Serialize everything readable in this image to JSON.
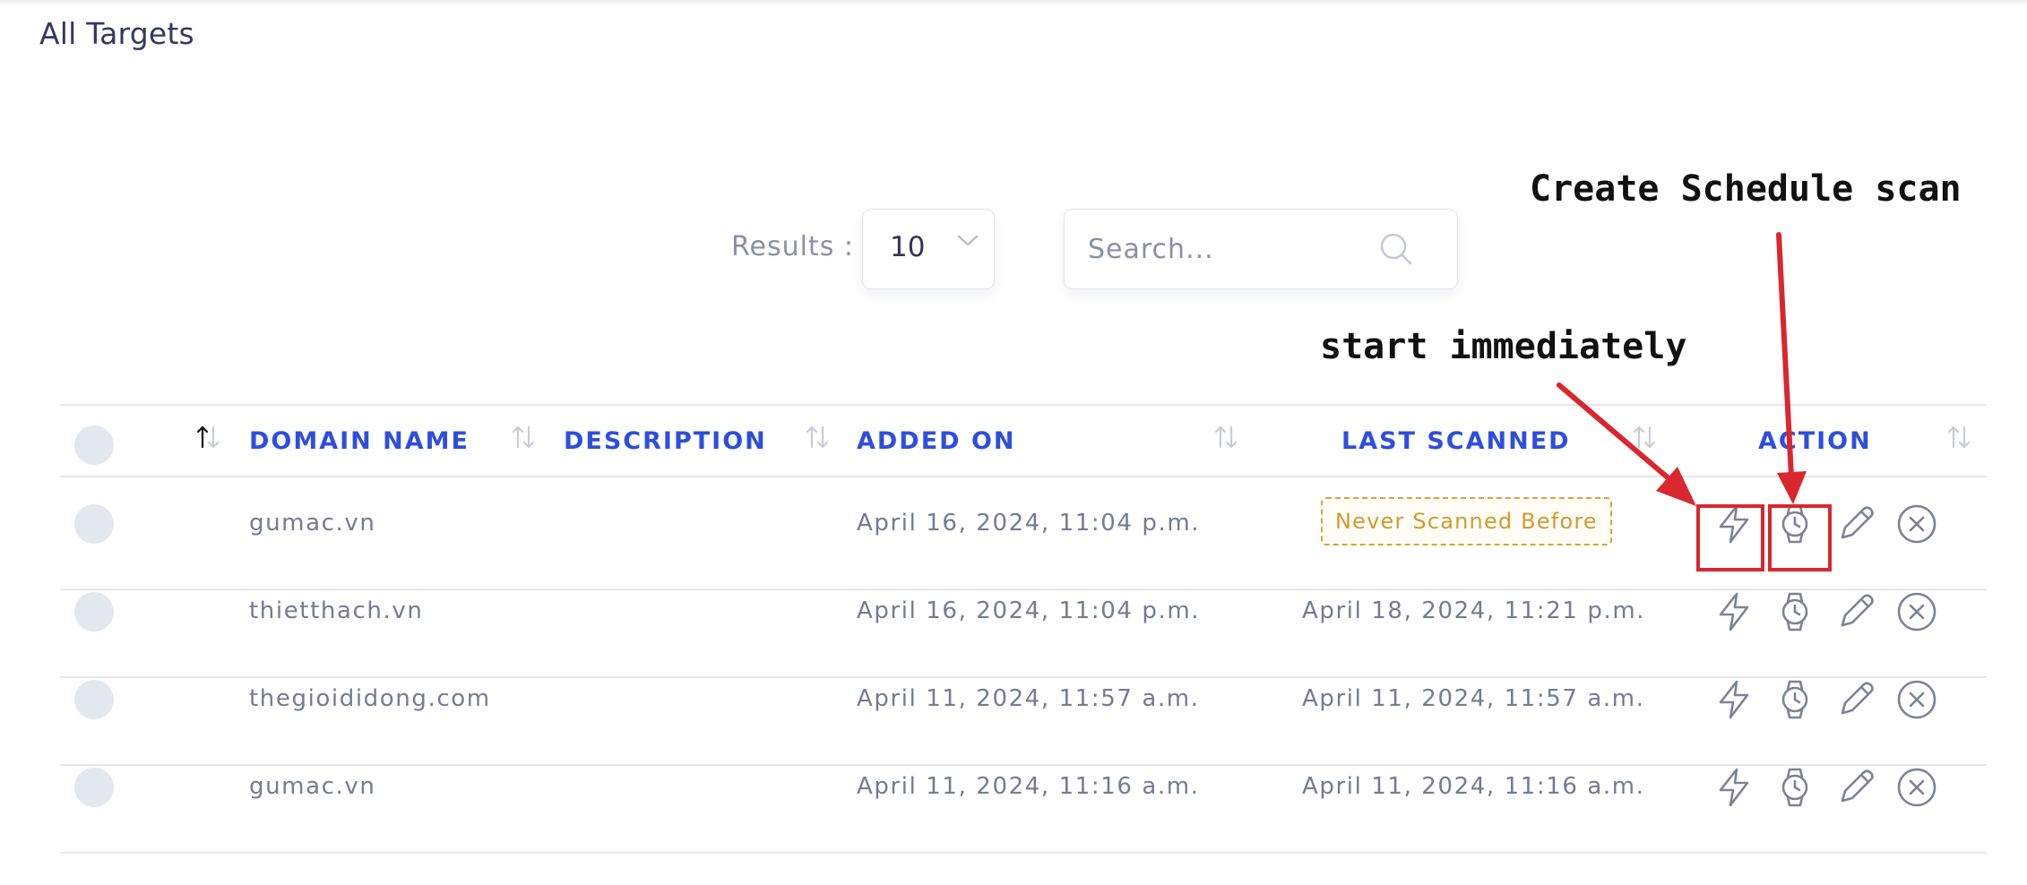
{
  "page": {
    "title": "All Targets"
  },
  "controls": {
    "results_label": "Results :",
    "page_size": "10",
    "search_placeholder": "Search..."
  },
  "table": {
    "columns": [
      "DOMAIN NAME",
      "DESCRIPTION",
      "ADDED ON",
      "LAST SCANNED",
      "ACTION"
    ],
    "rows": [
      {
        "domain": "gumac.vn",
        "description": "",
        "added_on": "April 16, 2024, 11:04 p.m.",
        "last_scanned": "Never Scanned Before",
        "never_scanned": true
      },
      {
        "domain": "thietthach.vn",
        "description": "",
        "added_on": "April 16, 2024, 11:04 p.m.",
        "last_scanned": "April 18, 2024, 11:21 p.m.",
        "never_scanned": false
      },
      {
        "domain": "thegioididong.com",
        "description": "",
        "added_on": "April 11, 2024, 11:57 a.m.",
        "last_scanned": "April 11, 2024, 11:57 a.m.",
        "never_scanned": false
      },
      {
        "domain": "gumac.vn",
        "description": "",
        "added_on": "April 11, 2024, 11:16 a.m.",
        "last_scanned": "April 11, 2024, 11:16 a.m.",
        "never_scanned": false
      }
    ],
    "action_icons": [
      "lightning-icon",
      "watch-icon",
      "pencil-icon",
      "close-circle-icon"
    ]
  },
  "annotations": {
    "schedule": "Create Schedule scan",
    "immediate": "start immediately"
  },
  "colors": {
    "header_text": "#2e4ede",
    "badge": "#d7a33b",
    "annotation_box": "#d9262f",
    "icon": "#7c8297"
  }
}
